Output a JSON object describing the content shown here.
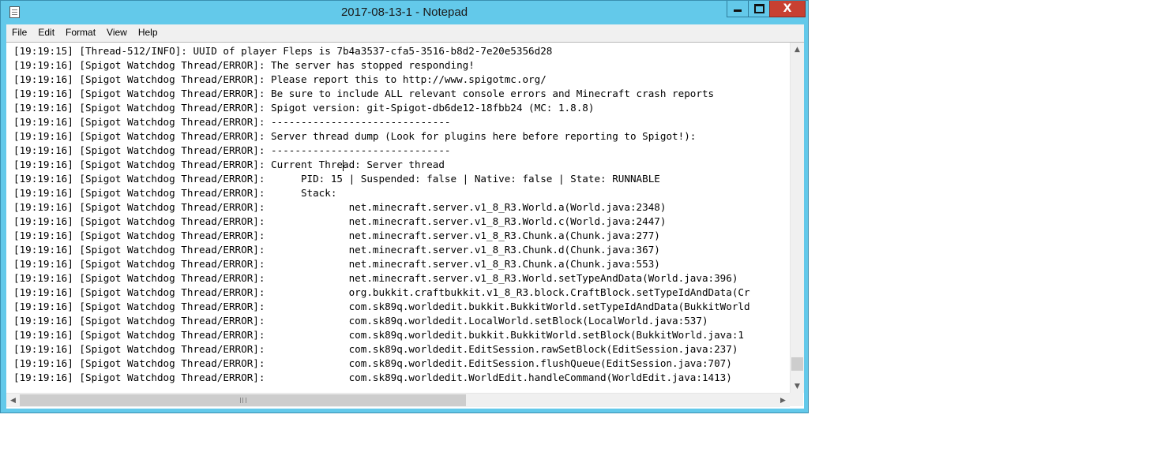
{
  "window": {
    "title": "2017-08-13-1 - Notepad",
    "accent": "#63c9ea",
    "close_color": "#c84031"
  },
  "icons": {
    "app": "notepad-icon",
    "minimize": "minimize-icon",
    "maximize": "maximize-icon",
    "close": "close-icon",
    "close_glyph": "X"
  },
  "menu": [
    "File",
    "Edit",
    "Format",
    "View",
    "Help"
  ],
  "lines": [
    "[19:19:15] [Thread-512/INFO]: UUID of player Fleps is 7b4a3537-cfa5-3516-b8d2-7e20e5356d28",
    "[19:19:16] [Spigot Watchdog Thread/ERROR]: The server has stopped responding!",
    "[19:19:16] [Spigot Watchdog Thread/ERROR]: Please report this to http://www.spigotmc.org/",
    "[19:19:16] [Spigot Watchdog Thread/ERROR]: Be sure to include ALL relevant console errors and Minecraft crash reports",
    "[19:19:16] [Spigot Watchdog Thread/ERROR]: Spigot version: git-Spigot-db6de12-18fbb24 (MC: 1.8.8)",
    "[19:19:16] [Spigot Watchdog Thread/ERROR]: ------------------------------",
    "[19:19:16] [Spigot Watchdog Thread/ERROR]: Server thread dump (Look for plugins here before reporting to Spigot!):",
    "[19:19:16] [Spigot Watchdog Thread/ERROR]: ------------------------------",
    "[19:19:16] [Spigot Watchdog Thread/ERROR]: Current Thread: Server thread",
    "[19:19:16] [Spigot Watchdog Thread/ERROR]:      PID: 15 | Suspended: false | Native: false | State: RUNNABLE",
    "[19:19:16] [Spigot Watchdog Thread/ERROR]:      Stack:",
    "[19:19:16] [Spigot Watchdog Thread/ERROR]:              net.minecraft.server.v1_8_R3.World.a(World.java:2348)",
    "[19:19:16] [Spigot Watchdog Thread/ERROR]:              net.minecraft.server.v1_8_R3.World.c(World.java:2447)",
    "[19:19:16] [Spigot Watchdog Thread/ERROR]:              net.minecraft.server.v1_8_R3.Chunk.a(Chunk.java:277)",
    "[19:19:16] [Spigot Watchdog Thread/ERROR]:              net.minecraft.server.v1_8_R3.Chunk.d(Chunk.java:367)",
    "[19:19:16] [Spigot Watchdog Thread/ERROR]:              net.minecraft.server.v1_8_R3.Chunk.a(Chunk.java:553)",
    "[19:19:16] [Spigot Watchdog Thread/ERROR]:              net.minecraft.server.v1_8_R3.World.setTypeAndData(World.java:396)",
    "[19:19:16] [Spigot Watchdog Thread/ERROR]:              org.bukkit.craftbukkit.v1_8_R3.block.CraftBlock.setTypeIdAndData(Cr",
    "[19:19:16] [Spigot Watchdog Thread/ERROR]:              com.sk89q.worldedit.bukkit.BukkitWorld.setTypeIdAndData(BukkitWorld",
    "[19:19:16] [Spigot Watchdog Thread/ERROR]:              com.sk89q.worldedit.LocalWorld.setBlock(LocalWorld.java:537)",
    "[19:19:16] [Spigot Watchdog Thread/ERROR]:              com.sk89q.worldedit.bukkit.BukkitWorld.setBlock(BukkitWorld.java:1",
    "[19:19:16] [Spigot Watchdog Thread/ERROR]:              com.sk89q.worldedit.EditSession.rawSetBlock(EditSession.java:237)",
    "[19:19:16] [Spigot Watchdog Thread/ERROR]:              com.sk89q.worldedit.EditSession.flushQueue(EditSession.java:707)",
    "[19:19:16] [Spigot Watchdog Thread/ERROR]:              com.sk89q.worldedit.WorldEdit.handleCommand(WorldEdit.java:1413)"
  ],
  "caret": {
    "line": 8,
    "column": 55
  },
  "scroll": {
    "vertical": 0.98,
    "horizontal": 0.0
  }
}
